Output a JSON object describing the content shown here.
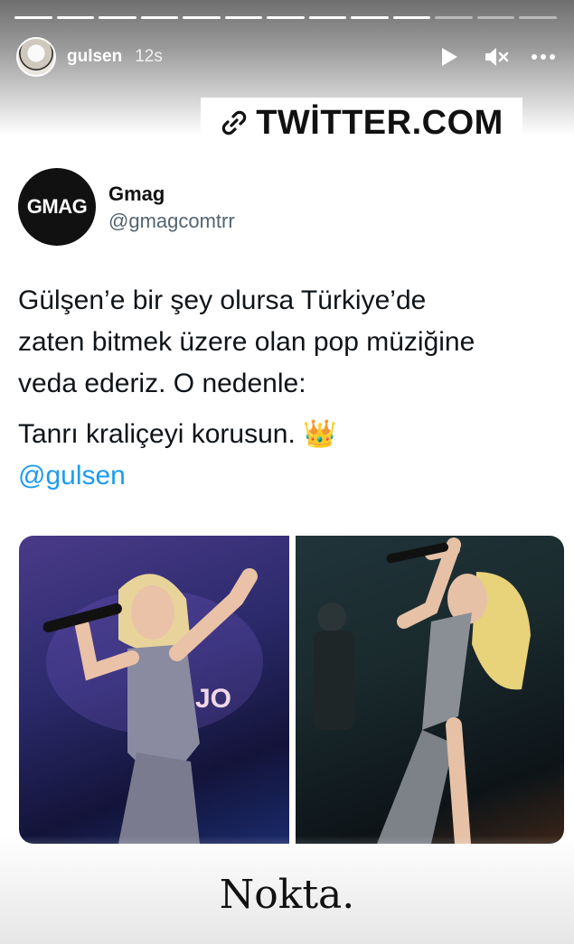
{
  "story": {
    "username": "gulsen",
    "time": "12s",
    "progress_total": 13,
    "progress_done": 10
  },
  "icons": {
    "play": "play-icon",
    "mute": "mute-icon",
    "more": "more-icon",
    "link": "link-icon"
  },
  "banner": {
    "text": "TWİTTER.COM"
  },
  "tweet": {
    "avatar_text": "GMAG",
    "display_name": "Gmag",
    "handle": "@gmagcomtrr",
    "line1": "Gülşen’e bir şey olursa Türkiye’de",
    "line2": "zaten bitmek üzere olan pop müziğine",
    "line3": "veda ederiz. O nedenle:",
    "line4": "Tanrı kraliçeyi korusun. 👑",
    "mention": "@gulsen"
  },
  "caption": "Nokta.",
  "colors": {
    "link": "#1d9bf0",
    "handle": "#536471"
  }
}
